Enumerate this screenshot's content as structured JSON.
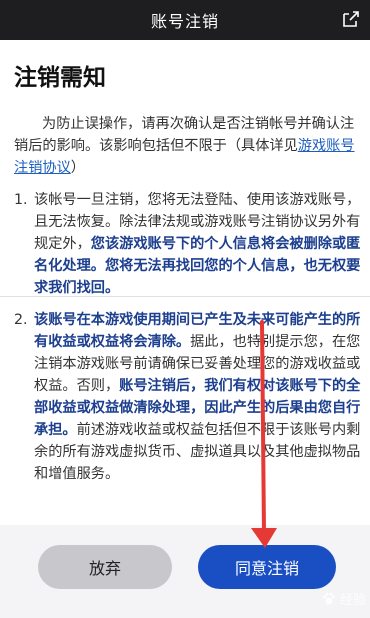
{
  "titlebar": {
    "title": "账号注销",
    "share_icon": "share-icon"
  },
  "content": {
    "heading": "注销需知",
    "intro_a": "为防止误操作，请再次确认是否注销帐号并确认注销后的影响。该影响包括但不限于（具体详见",
    "intro_link": "游戏账号注销协议",
    "intro_b": "）",
    "item1": {
      "num": "1.",
      "a": "该帐号一旦注销，您将无法登陆、使用该游戏账号，且无法恢复。除法律法规或游戏账号注销协议另外有规定外，",
      "b": "您该游戏账号下的个人信息将会被删除或匿名化处理。您将无法再找回您的个人信息，也无权要求我们找回。"
    },
    "item2": {
      "num": "2.",
      "a": "该账号在本游戏使用期间已产生及未来可能产生的所有收益或权益将会清除。",
      "b": "据此，也特别提示您，在您注销本游戏账号前请确保已妥善处理您的游戏收益或权益。否则，",
      "c": "账号注销后，我们有权对该账号下的全部收益或权益做清除处理，因此产生的后果由您自行承担。",
      "d": "前述游戏收益或权益包括但不限于该账号内剩余的所有游戏虚拟货币、虚拟道具以及其他虚拟物品和增值服务。"
    }
  },
  "footer": {
    "cancel_label": "放弃",
    "agree_label": "同意注销",
    "watermark": "经验"
  },
  "colors": {
    "title_bg": "#1e1e20",
    "accent": "#1a4fc4",
    "emphasis": "#1d3f8f",
    "arrow": "#e53935"
  }
}
